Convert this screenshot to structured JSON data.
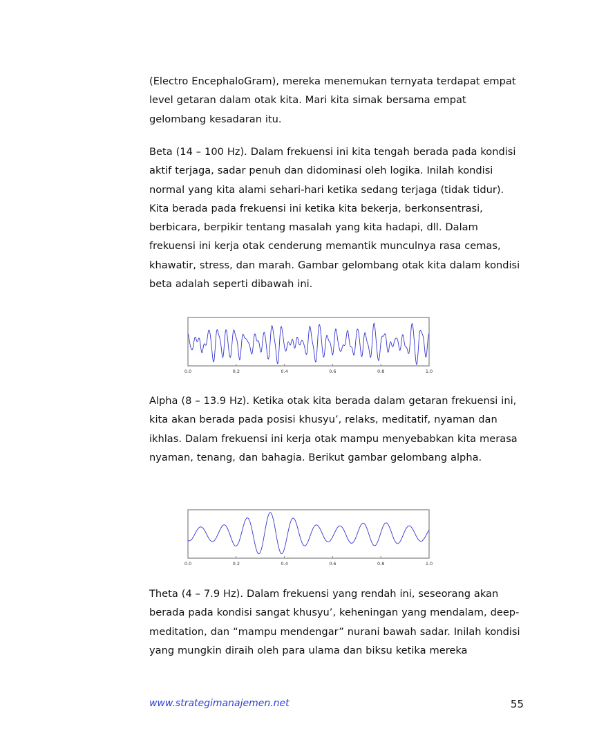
{
  "paragraphs": [
    "(Electro EncephaloGram), mereka menemukan ternyata terdapat empat level getaran dalam otak kita. Mari kita simak bersama empat gelombang kesadaran itu.",
    "Beta (14 – 100 Hz). Dalam frekuensi ini kita tengah berada pada kondisi aktif terjaga, sadar penuh dan didominasi oleh logika. Inilah kondisi normal yang kita alami sehari-hari ketika sedang terjaga (tidak tidur). Kita berada pada frekuensi ini ketika kita bekerja, berkonsentrasi, berbicara, berpikir tentang masalah yang kita hadapi, dll. Dalam frekuensi ini kerja otak cenderung memantik munculnya rasa cemas, khawatir, stress, dan marah. Gambar gelombang otak kita dalam kondisi beta adalah seperti dibawah ini.",
    "Alpha (8 – 13.9 Hz). Ketika otak kita berada dalam getaran frekuensi ini, kita akan berada pada posisi khusyu’, relaks, meditatif, nyaman dan ikhlas. Dalam frekuensi ini kerja otak mampu menyebabkan kita merasa nyaman, tenang, dan bahagia. Berikut gambar gelombang alpha.",
    "Theta (4 – 7.9 Hz). Dalam frekuensi yang rendah ini, seseorang akan berada pada kondisi sangat khusyu’, keheningan yang mendalam, deep-meditation, dan “mampu mendengar” nurani bawah sadar. Inilah kondisi yang mungkin diraih oleh para ulama dan biksu ketika mereka"
  ],
  "chart_data": [
    {
      "type": "line",
      "wave": "beta",
      "xlim": [
        0.0,
        1.0
      ],
      "x_ticks": [
        "0.0",
        "0.2",
        "0.4",
        "0.6",
        "0.8",
        "1.0"
      ],
      "line_color": "#3333cc"
    },
    {
      "type": "line",
      "wave": "alpha",
      "xlim": [
        0.0,
        1.0
      ],
      "x_ticks": [
        "0.0",
        "0.2",
        "0.4",
        "0.6",
        "0.8",
        "1.0"
      ],
      "line_color": "#3333cc"
    }
  ],
  "footer": {
    "url": "www.strategimanajemen.net",
    "page_number": "55"
  }
}
